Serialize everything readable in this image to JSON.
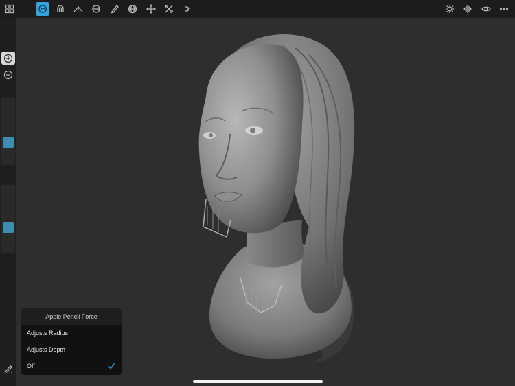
{
  "toolbar": {
    "left_tools": [
      {
        "icon": "grid-menu-icon"
      },
      {
        "icon": "clay-brush-icon",
        "active": true
      },
      {
        "icon": "magnet-icon"
      },
      {
        "icon": "crease-icon"
      },
      {
        "icon": "flatten-icon"
      },
      {
        "icon": "pencil-draw-icon"
      },
      {
        "icon": "sphere-icon"
      },
      {
        "icon": "move-icon"
      },
      {
        "icon": "transform-icon"
      },
      {
        "icon": "more-tools-icon"
      }
    ],
    "right_tools": [
      {
        "icon": "lighting-icon"
      },
      {
        "icon": "symmetry-icon"
      },
      {
        "icon": "view-eye-icon"
      },
      {
        "icon": "more-options-icon"
      }
    ]
  },
  "sidebar": {
    "add_icon": "plus-circle-icon",
    "remove_icon": "minus-circle-icon",
    "radius_slider_value": 0.3,
    "intensity_slider_value": 0.35
  },
  "popover": {
    "title": "Apple Pencil Force",
    "items": [
      {
        "label": "Adjusts Radius",
        "checked": false
      },
      {
        "label": "Adjusts Depth",
        "checked": false
      },
      {
        "label": "Off",
        "checked": true
      }
    ]
  },
  "colors": {
    "accent": "#35a4e0",
    "slider_thumb": "#3e8db0",
    "background": "#2e2e2e",
    "check": "#3aa6e6"
  }
}
